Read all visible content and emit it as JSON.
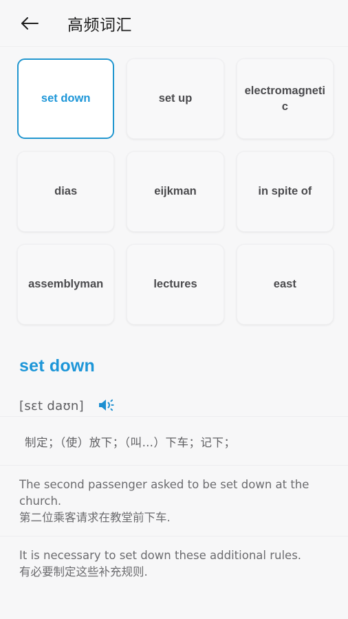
{
  "header": {
    "back_icon": "arrow-left-icon",
    "title": "高频词汇"
  },
  "word_grid": {
    "cards": [
      {
        "label": "set down",
        "selected": true
      },
      {
        "label": "set up",
        "selected": false
      },
      {
        "label": "electromagnetic",
        "selected": false
      },
      {
        "label": "dias",
        "selected": false
      },
      {
        "label": "eijkman",
        "selected": false
      },
      {
        "label": "in spite of",
        "selected": false
      },
      {
        "label": "assemblyman",
        "selected": false
      },
      {
        "label": "lectures",
        "selected": false
      },
      {
        "label": "east",
        "selected": false
      }
    ]
  },
  "detail": {
    "word": "set down",
    "phonetic": "[sɛt daʊn]",
    "speaker_icon": "speaker-icon",
    "definition": "制定；（使）放下；（叫…）下车；记下；",
    "examples": [
      {
        "en": "The second passenger asked to be set down at the church.",
        "cn": "第二位乘客请求在教堂前下车."
      },
      {
        "en": "It is necessary to set down these additional rules.",
        "cn": "有必要制定这些补充规则."
      }
    ]
  },
  "colors": {
    "accent": "#1d96d8",
    "selected_border": "#2196cf",
    "background": "#f7f7f8",
    "text_primary": "#1b1b1b",
    "text_secondary": "#6b6b6e"
  }
}
